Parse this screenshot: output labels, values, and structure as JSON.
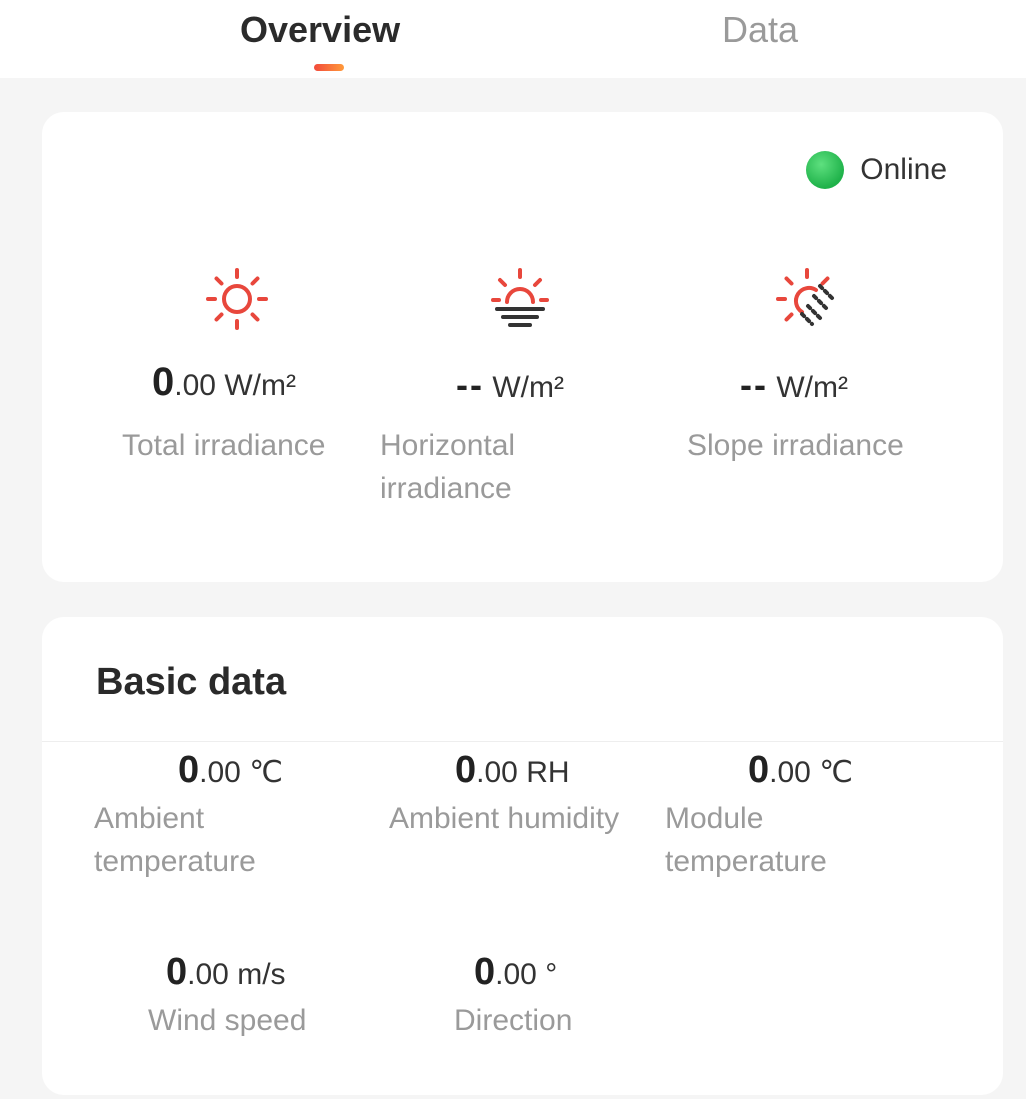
{
  "tabs": [
    {
      "label": "Overview",
      "active": true
    },
    {
      "label": "Data",
      "active": false
    }
  ],
  "status": {
    "label": "Online",
    "color": "#22b24c"
  },
  "irradiance": [
    {
      "icon": "sun-icon",
      "int": "0",
      "dec": ".00",
      "unit": "W/m²",
      "label": "Total irradiance"
    },
    {
      "icon": "sun-horizon-icon",
      "int": "--",
      "dec": "",
      "unit": "W/m²",
      "label": "Horizontal irradiance"
    },
    {
      "icon": "sun-slope-icon",
      "int": "--",
      "dec": "",
      "unit": "W/m²",
      "label": "Slope irradiance"
    }
  ],
  "basic": {
    "title": "Basic data",
    "items": [
      {
        "int": "0",
        "dec": ".00",
        "unit": "℃",
        "label": "Ambient temperature"
      },
      {
        "int": "0",
        "dec": ".00",
        "unit": "RH",
        "label": "Ambient humidity"
      },
      {
        "int": "0",
        "dec": ".00",
        "unit": "℃",
        "label": "Module temperature"
      },
      {
        "int": "0",
        "dec": ".00",
        "unit": "m/s",
        "label": "Wind speed"
      },
      {
        "int": "0",
        "dec": ".00",
        "unit": "°",
        "label": "Direction"
      }
    ]
  },
  "colors": {
    "accent": "#f24a3b",
    "icon_red": "#e8473c",
    "muted": "#9a9a9a"
  }
}
